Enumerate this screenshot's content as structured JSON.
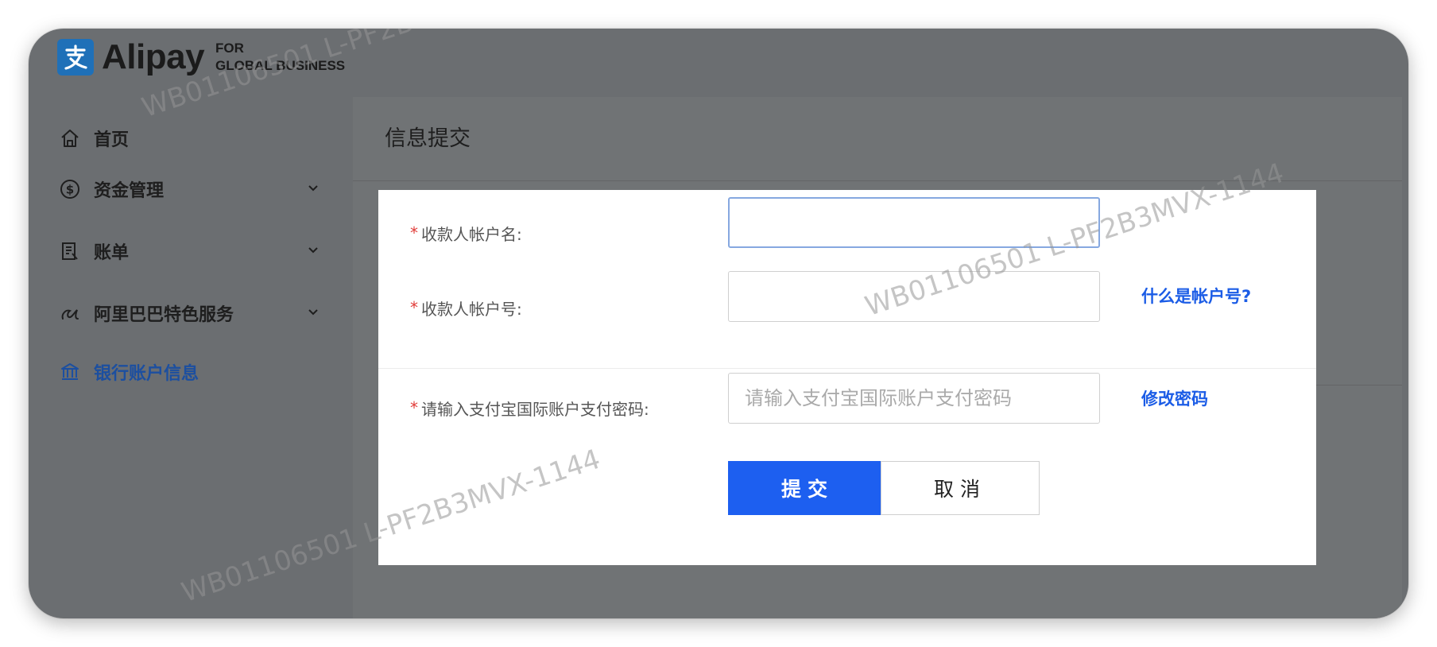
{
  "brand": {
    "name": "Alipay",
    "sub_line1": "FOR",
    "sub_line2": "GLOBAL BUSINESS",
    "mark_glyph": "支",
    "color": "#1f70b8"
  },
  "sidebar": {
    "items": [
      {
        "label": "首页",
        "icon": "home-icon",
        "expandable": false,
        "active": false
      },
      {
        "label": "资金管理",
        "icon": "dollar-circle-icon",
        "expandable": true,
        "active": false
      },
      {
        "label": "账单",
        "icon": "bill-icon",
        "expandable": true,
        "active": false
      },
      {
        "label": "阿里巴巴特色服务",
        "icon": "alibaba-icon",
        "expandable": true,
        "active": false
      },
      {
        "label": "银行账户信息",
        "icon": "bank-icon",
        "expandable": false,
        "active": true
      }
    ],
    "active_color": "#1c4fa0"
  },
  "panel": {
    "title": "信息提交"
  },
  "form": {
    "required_mark": "*",
    "account_name": {
      "label": "收款人帐户名:",
      "value": "",
      "placeholder": ""
    },
    "account_number": {
      "label": "收款人帐户号:",
      "value": "",
      "placeholder": "",
      "help_link": "什么是帐户号?"
    },
    "password": {
      "label": "请输入支付宝国际账户支付密码:",
      "value": "",
      "placeholder": "请输入支付宝国际账户支付密码",
      "help_link": "修改密码"
    },
    "submit_label": "提交",
    "cancel_label": "取消",
    "primary_color": "#1d5ff0"
  },
  "watermark": {
    "text": "WB01106501 L-PF2B3MVX-1144"
  }
}
